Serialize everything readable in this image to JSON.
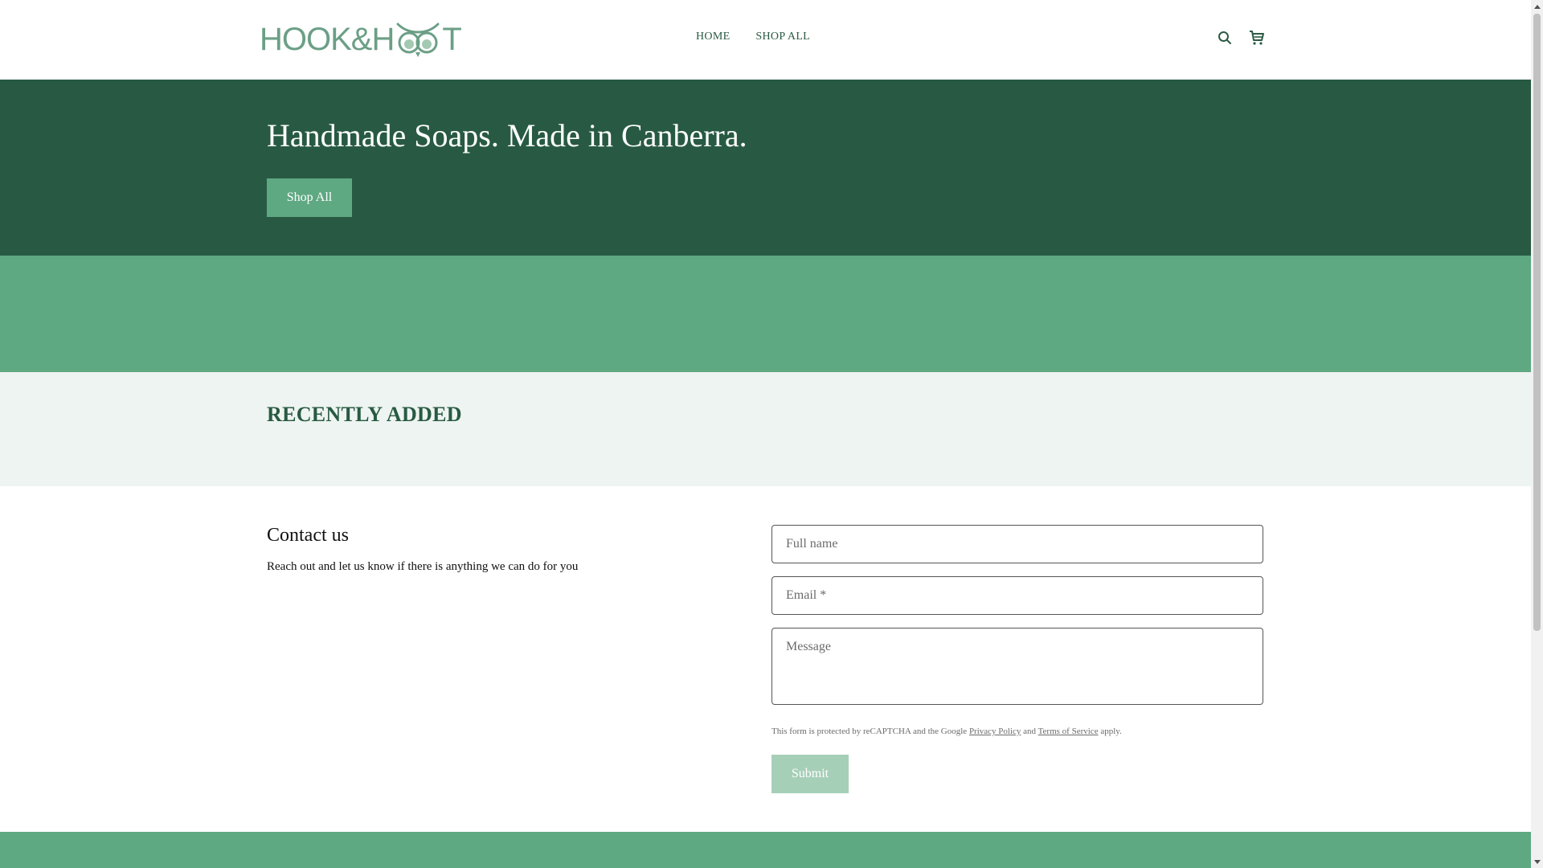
{
  "header": {
    "logo": {
      "left": "HOOK",
      "amp": "&",
      "h": "H",
      "right": "T"
    },
    "nav": [
      {
        "label": "HOME"
      },
      {
        "label": "SHOP ALL"
      }
    ],
    "icons": {
      "search": "search-icon",
      "cart": "cart-icon"
    }
  },
  "hero": {
    "title": "Handmade Soaps. Made in Canberra.",
    "button_label": "Shop All"
  },
  "recent": {
    "title": "RECENTLY ADDED"
  },
  "contact": {
    "title": "Contact us",
    "subtitle": "Reach out and let us know if there is anything we can do for you",
    "fields": {
      "name_placeholder": "Full name",
      "email_placeholder": "Email *",
      "message_placeholder": "Message"
    },
    "legal": {
      "prefix": "This form is protected by reCAPTCHA and the Google ",
      "privacy": "Privacy Policy",
      "and": " and ",
      "terms": "Terms of Service",
      "suffix": " apply."
    },
    "submit_label": "Submit"
  },
  "colors": {
    "brand_dark": "#285a43",
    "brand_mid": "#5ea882",
    "brand_light": "#eef4f1",
    "submit_disabled": "#a6cfb8"
  }
}
